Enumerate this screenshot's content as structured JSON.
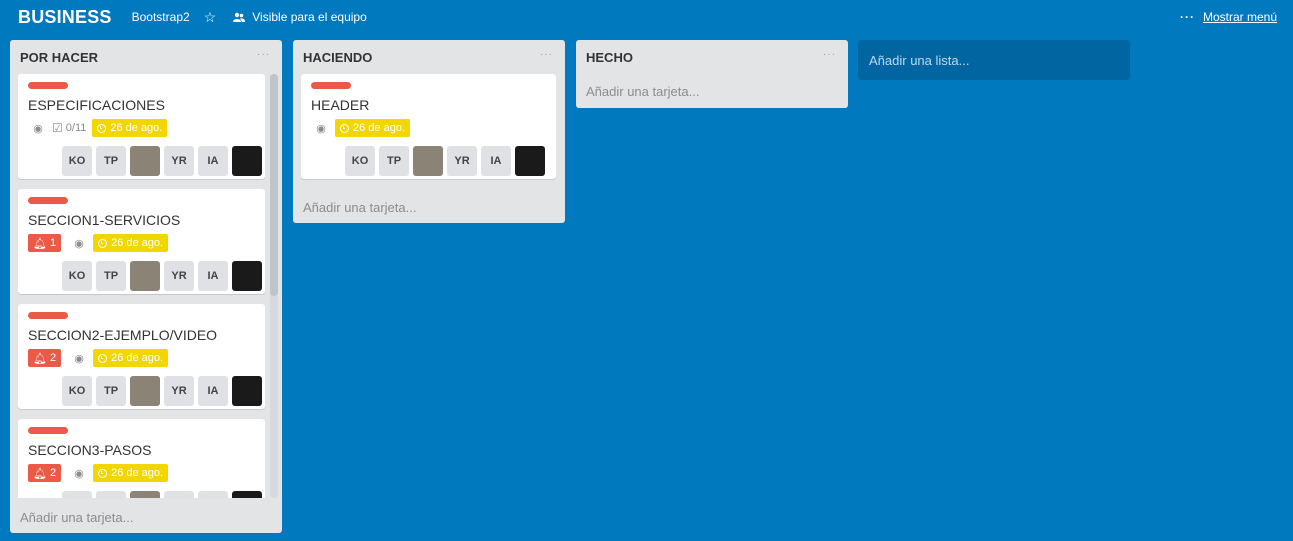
{
  "board": {
    "title": "BUSINESS",
    "team": "Bootstrap2",
    "star_icon": "star-icon",
    "visibility": "Visible para el equipo",
    "menu_label": "Mostrar menú",
    "background_color": "#0079bf"
  },
  "lists": [
    {
      "title": "POR HACER",
      "add_card": "Añadir una tarjeta...",
      "cards": [
        {
          "title": "ESPECIFICACIONES",
          "label_color": "#eb5a46",
          "watch": true,
          "checklist": "0/11",
          "notifications": "",
          "due": "26 de ago.",
          "members": [
            "KO",
            "TP",
            "",
            "YR",
            "IA",
            ""
          ]
        },
        {
          "title": "SECCION1-SERVICIOS",
          "label_color": "#eb5a46",
          "watch": true,
          "checklist": "",
          "notifications": "1",
          "due": "26 de ago.",
          "members": [
            "KO",
            "TP",
            "",
            "YR",
            "IA",
            ""
          ]
        },
        {
          "title": "SECCION2-EJEMPLO/VIDEO",
          "label_color": "#eb5a46",
          "watch": true,
          "checklist": "",
          "notifications": "2",
          "due": "26 de ago.",
          "members": [
            "KO",
            "TP",
            "",
            "YR",
            "IA",
            ""
          ]
        },
        {
          "title": "SECCION3-PASOS",
          "label_color": "#eb5a46",
          "watch": true,
          "checklist": "",
          "notifications": "2",
          "due": "26 de ago.",
          "members": [
            "KO",
            "TP",
            "",
            "YR",
            "IA",
            ""
          ]
        }
      ]
    },
    {
      "title": "HACIENDO",
      "add_card": "Añadir una tarjeta...",
      "cards": [
        {
          "title": "HEADER",
          "label_color": "#eb5a46",
          "watch": true,
          "checklist": "",
          "notifications": "",
          "due": "26 de ago.",
          "members": [
            "KO",
            "TP",
            "",
            "YR",
            "IA",
            ""
          ]
        }
      ]
    },
    {
      "title": "HECHO",
      "add_card": "Añadir una tarjeta...",
      "cards": []
    }
  ],
  "add_list": "Añadir una lista..."
}
